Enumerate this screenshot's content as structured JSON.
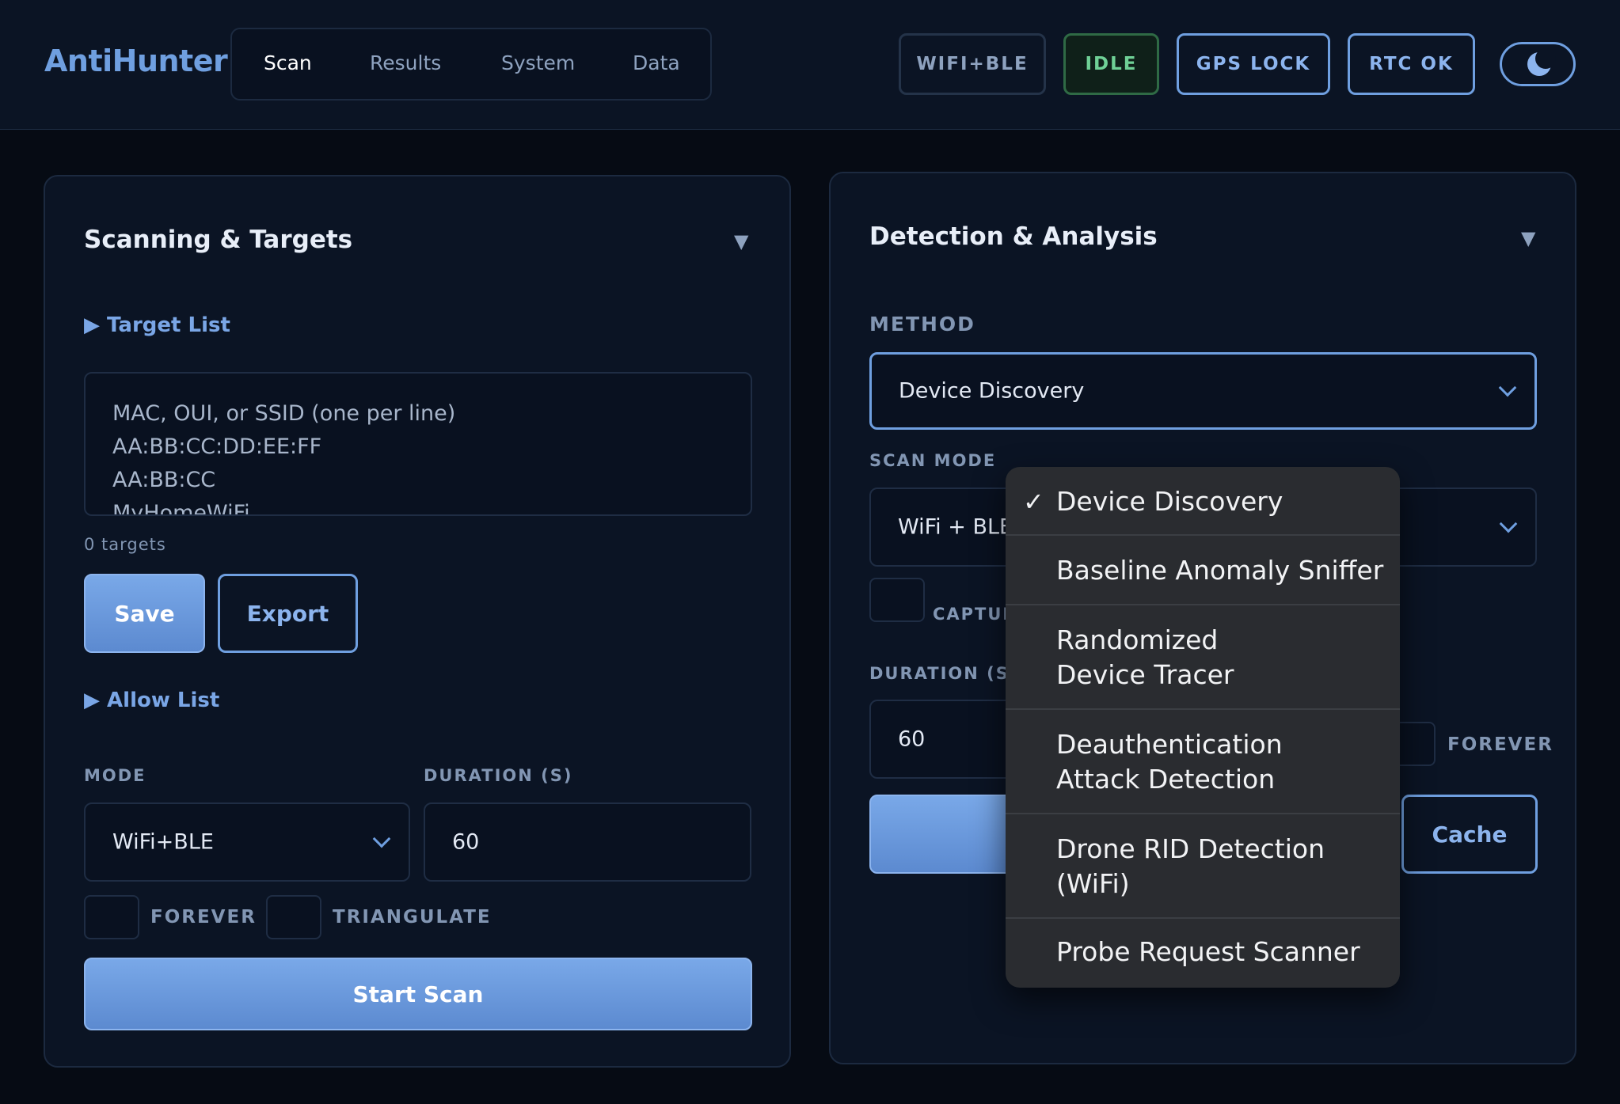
{
  "header": {
    "brand": "AntiHunter",
    "tabs": [
      "Scan",
      "Results",
      "System",
      "Data"
    ],
    "status": {
      "mode": "WIFI+BLE",
      "state": "IDLE",
      "gps": "GPS LOCK",
      "rtc": "RTC OK"
    },
    "theme_icon": "moon-icon"
  },
  "scanning_panel": {
    "title": "Scanning & Targets",
    "collapse_icon": "▼",
    "target_list_label": "Target List",
    "target_placeholder_lines": [
      "MAC, OUI, or SSID (one per line)",
      "AA:BB:CC:DD:EE:FF",
      "AA:BB:CC",
      "MyHomeWiFi"
    ],
    "target_count": "0 targets",
    "save_label": "Save",
    "export_label": "Export",
    "allow_list_label": "Allow List",
    "mode_label": "MODE",
    "mode_value": "WiFi+BLE",
    "duration_label": "DURATION (S)",
    "duration_value": "60",
    "forever_label": "FOREVER",
    "triangulate_label": "TRIANGULATE",
    "start_label": "Start Scan"
  },
  "detection_panel": {
    "title": "Detection & Analysis",
    "collapse_icon": "▼",
    "method_label": "METHOD",
    "method_value": "Device Discovery",
    "scan_mode_label": "SCAN MODE",
    "scan_mode_value": "WiFi + BLE",
    "capture_label": "CAPTUR",
    "duration_label": "DURATION (S)",
    "duration_value": "60",
    "forever_label": "FOREVER",
    "cache_label": "Cache"
  },
  "method_menu": {
    "selected_mark": "✓",
    "options": [
      [
        "Device Discovery"
      ],
      [
        "Baseline Anomaly Sniffer"
      ],
      [
        "Randomized",
        "Device Tracer"
      ],
      [
        "Deauthentication",
        "Attack Detection"
      ],
      [
        "Drone RID Detection",
        "(WiFi)"
      ],
      [
        "Probe Request Scanner"
      ]
    ]
  }
}
